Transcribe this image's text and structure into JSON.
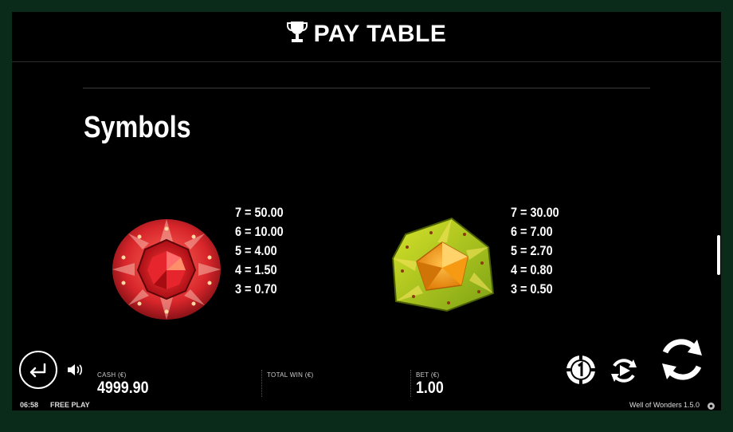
{
  "header": {
    "title": "PAY TABLE",
    "icon": "trophy-icon"
  },
  "section": {
    "title": "Symbols"
  },
  "symbols": [
    {
      "name": "red-gem",
      "color": "#e0302e",
      "pays": [
        "7 = 50.00",
        "6 = 10.00",
        "5 = 4.00",
        "4 = 1.50",
        "3 = 0.70"
      ]
    },
    {
      "name": "orange-gem",
      "color": "#f29a10",
      "pays": [
        "7 = 30.00",
        "6 = 7.00",
        "5 = 2.70",
        "4 = 0.80",
        "3 = 0.50"
      ]
    }
  ],
  "hud": {
    "cash_label": "CASH (€)",
    "cash_value": "4999.90",
    "total_win_label": "TOTAL WIN (€)",
    "bet_label": "BET (€)",
    "bet_value": "1.00"
  },
  "footer": {
    "time": "06:58",
    "mode": "FREE PLAY",
    "game_name": "Well of Wonders",
    "version": "1.5.0"
  },
  "colors": {
    "background": "#000000",
    "outer": "#0a2a1a",
    "text": "#ffffff"
  }
}
